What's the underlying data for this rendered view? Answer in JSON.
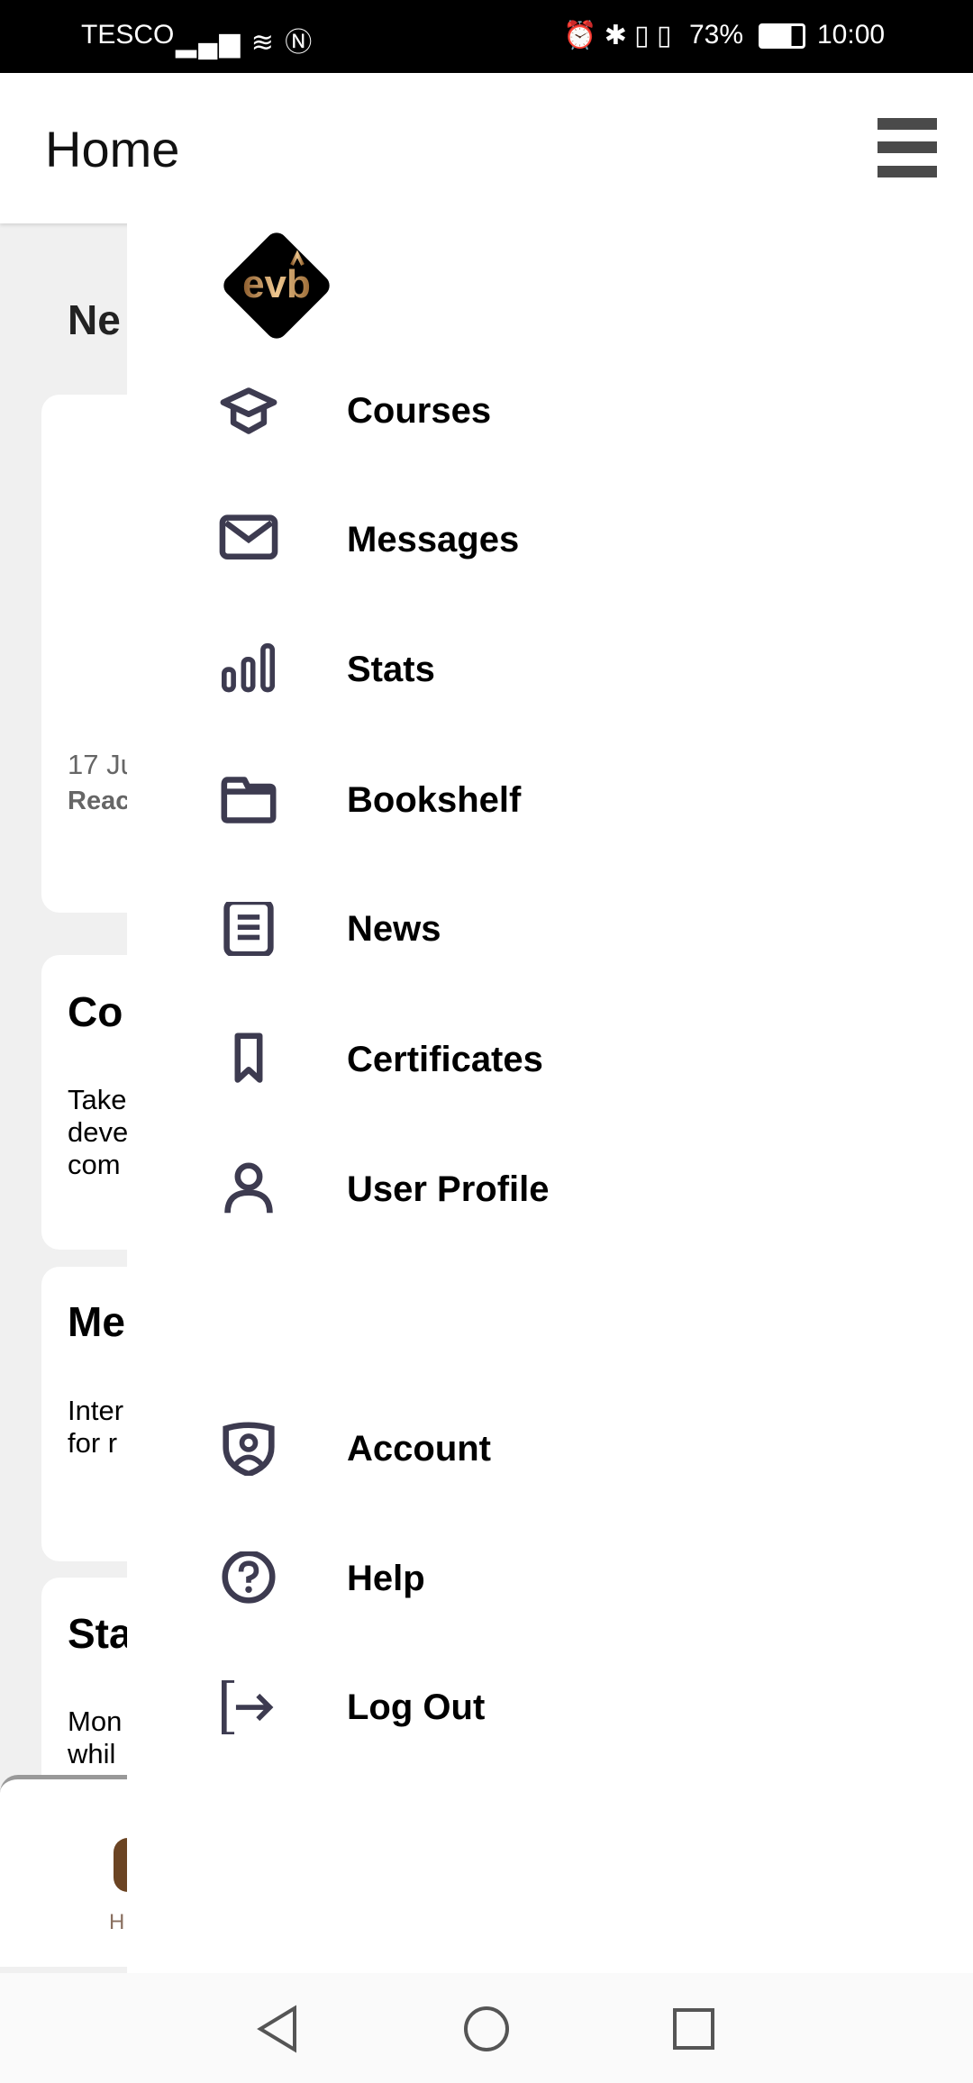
{
  "status_bar": {
    "carrier": "TESCO",
    "battery": "73%",
    "time": "10:00"
  },
  "header": {
    "title": "Home",
    "menu_icon": "hamburger-icon"
  },
  "background": {
    "section_title": "Ne",
    "card1": {
      "date": "17 Ju",
      "link": "Reac"
    },
    "card2": {
      "title": "Co",
      "lines": [
        "Take",
        "deve",
        "com"
      ]
    },
    "card3": {
      "title": "Me",
      "lines": [
        "Inter",
        "for r"
      ]
    },
    "card4": {
      "title": "Sta",
      "lines": [
        "Mon",
        "whil"
      ]
    },
    "bottom_nav": {
      "home_label": "H",
      "accent": "#6b4423"
    }
  },
  "drawer": {
    "logo_text": "evb",
    "items": [
      {
        "label": "Courses",
        "icon": "graduation-cap-icon"
      },
      {
        "label": "Messages",
        "icon": "envelope-icon"
      },
      {
        "label": "Stats",
        "icon": "bar-chart-icon"
      },
      {
        "label": "Bookshelf",
        "icon": "folder-icon"
      },
      {
        "label": "News",
        "icon": "document-icon"
      },
      {
        "label": "Certificates",
        "icon": "bookmark-icon"
      },
      {
        "label": "User Profile",
        "icon": "user-icon"
      },
      {
        "label": "Account",
        "icon": "shield-user-icon"
      },
      {
        "label": "Help",
        "icon": "help-circle-icon"
      },
      {
        "label": "Log Out",
        "icon": "logout-icon"
      }
    ],
    "icon_color": "#3d3b50"
  }
}
